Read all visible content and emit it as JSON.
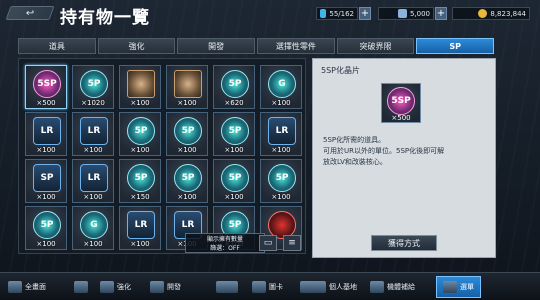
{
  "header": {
    "back_label": "↩",
    "title": "持有物一覽"
  },
  "resources": [
    {
      "value": "55/162",
      "color": "#3fb6e8"
    },
    {
      "value": "5,000",
      "color": "#8ab4dd"
    },
    {
      "value": "8,823,844",
      "color": "#e8b83a"
    }
  ],
  "tabs": [
    {
      "label": "道具",
      "active": false
    },
    {
      "label": "強化",
      "active": false
    },
    {
      "label": "開發",
      "active": false
    },
    {
      "label": "選擇性零件",
      "active": false
    },
    {
      "label": "突破界限",
      "active": false
    },
    {
      "label": "SP",
      "active": true
    }
  ],
  "items": [
    {
      "text": "5SP",
      "qty": "×500",
      "style": "pink",
      "selected": true
    },
    {
      "text": "5P",
      "qty": "×1020",
      "style": "cyan"
    },
    {
      "text": "",
      "qty": "×100",
      "style": "face"
    },
    {
      "text": "",
      "qty": "×100",
      "style": "face"
    },
    {
      "text": "5P",
      "qty": "×620",
      "style": "cyan"
    },
    {
      "text": "G",
      "qty": "×100",
      "style": "cyan"
    },
    {
      "text": "LR",
      "qty": "×100",
      "style": "badge"
    },
    {
      "text": "LR",
      "qty": "×100",
      "style": "badge"
    },
    {
      "text": "5P",
      "qty": "×100",
      "style": "cyan"
    },
    {
      "text": "5P",
      "qty": "×100",
      "style": "cyan"
    },
    {
      "text": "5P",
      "qty": "×100",
      "style": "cyan"
    },
    {
      "text": "LR",
      "qty": "×100",
      "style": "badge"
    },
    {
      "text": "SP",
      "qty": "×100",
      "style": "badge"
    },
    {
      "text": "LR",
      "qty": "×100",
      "style": "badge"
    },
    {
      "text": "5P",
      "qty": "×150",
      "style": "cyan"
    },
    {
      "text": "5P",
      "qty": "×100",
      "style": "cyan"
    },
    {
      "text": "5P",
      "qty": "×100",
      "style": "cyan"
    },
    {
      "text": "5P",
      "qty": "×100",
      "style": "cyan"
    },
    {
      "text": "5P",
      "qty": "×100",
      "style": "cyan"
    },
    {
      "text": "G",
      "qty": "×100",
      "style": "cyan"
    },
    {
      "text": "LR",
      "qty": "×100",
      "style": "badge"
    },
    {
      "text": "LR",
      "qty": "×100",
      "style": "badge"
    },
    {
      "text": "5P",
      "qty": "×100",
      "style": "cyan"
    },
    {
      "text": "",
      "qty": "",
      "style": "red"
    }
  ],
  "filter_overlay": {
    "line1": "顯示擁有數量",
    "line2": "篩選：OFF"
  },
  "detail": {
    "title": "5SP化晶片",
    "icon_text": "5SP",
    "icon_qty": "×500",
    "desc_line1": "5SP化所需的道具。",
    "desc_line2": "可用於UR以外的單位。5SP化後即可解",
    "desc_line3": "放改LV和改裝核心。",
    "obtain_label": "獲得方式"
  },
  "bottom_nav": [
    {
      "label": "全畫面",
      "active": false
    },
    {
      "label": "",
      "active": false
    },
    {
      "label": "強化",
      "active": false
    },
    {
      "label": "開發",
      "active": false
    },
    {
      "label": "",
      "active": false
    },
    {
      "label": "圖卡",
      "active": false
    },
    {
      "label": "",
      "active": false
    },
    {
      "label": "個人基地",
      "active": false
    },
    {
      "label": "機體補給",
      "active": false
    },
    {
      "label": "選單",
      "active": true
    }
  ]
}
